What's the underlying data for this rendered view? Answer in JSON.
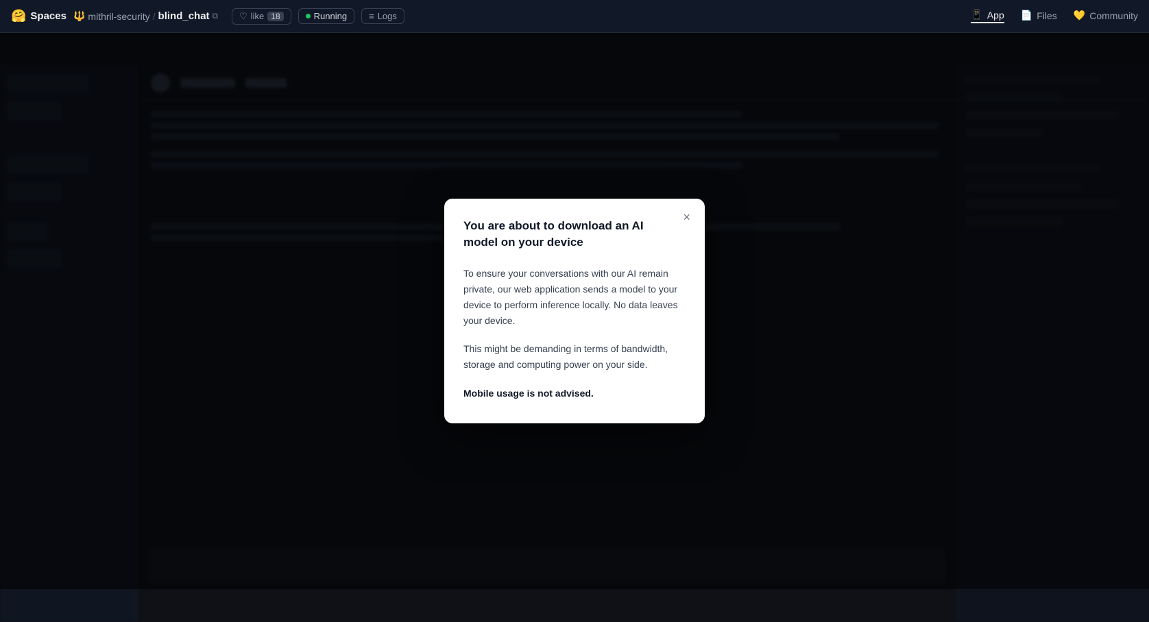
{
  "navbar": {
    "spaces_label": "Spaces",
    "spaces_emoji": "🤗",
    "owner_emoji": "🔱",
    "owner_name": "mithril-security",
    "separator": "/",
    "repo_name": "blind_chat",
    "like_label": "like",
    "like_count": "18",
    "status_label": "Running",
    "logs_label": "Logs",
    "tabs": [
      {
        "id": "app",
        "label": "App",
        "icon": "📱",
        "active": true
      },
      {
        "id": "files",
        "label": "Files",
        "icon": "📄",
        "active": false
      },
      {
        "id": "community",
        "label": "Community",
        "icon": "💛",
        "active": false
      }
    ]
  },
  "modal": {
    "title": "You are about to download an AI model on your device",
    "close_label": "×",
    "paragraph1": "To ensure your conversations with our AI remain private, our web application sends a model to your device to perform inference locally. No data leaves your device.",
    "paragraph2": "This might be demanding in terms of bandwidth, storage and computing power on your side.",
    "paragraph3": "Mobile usage is not advised."
  }
}
